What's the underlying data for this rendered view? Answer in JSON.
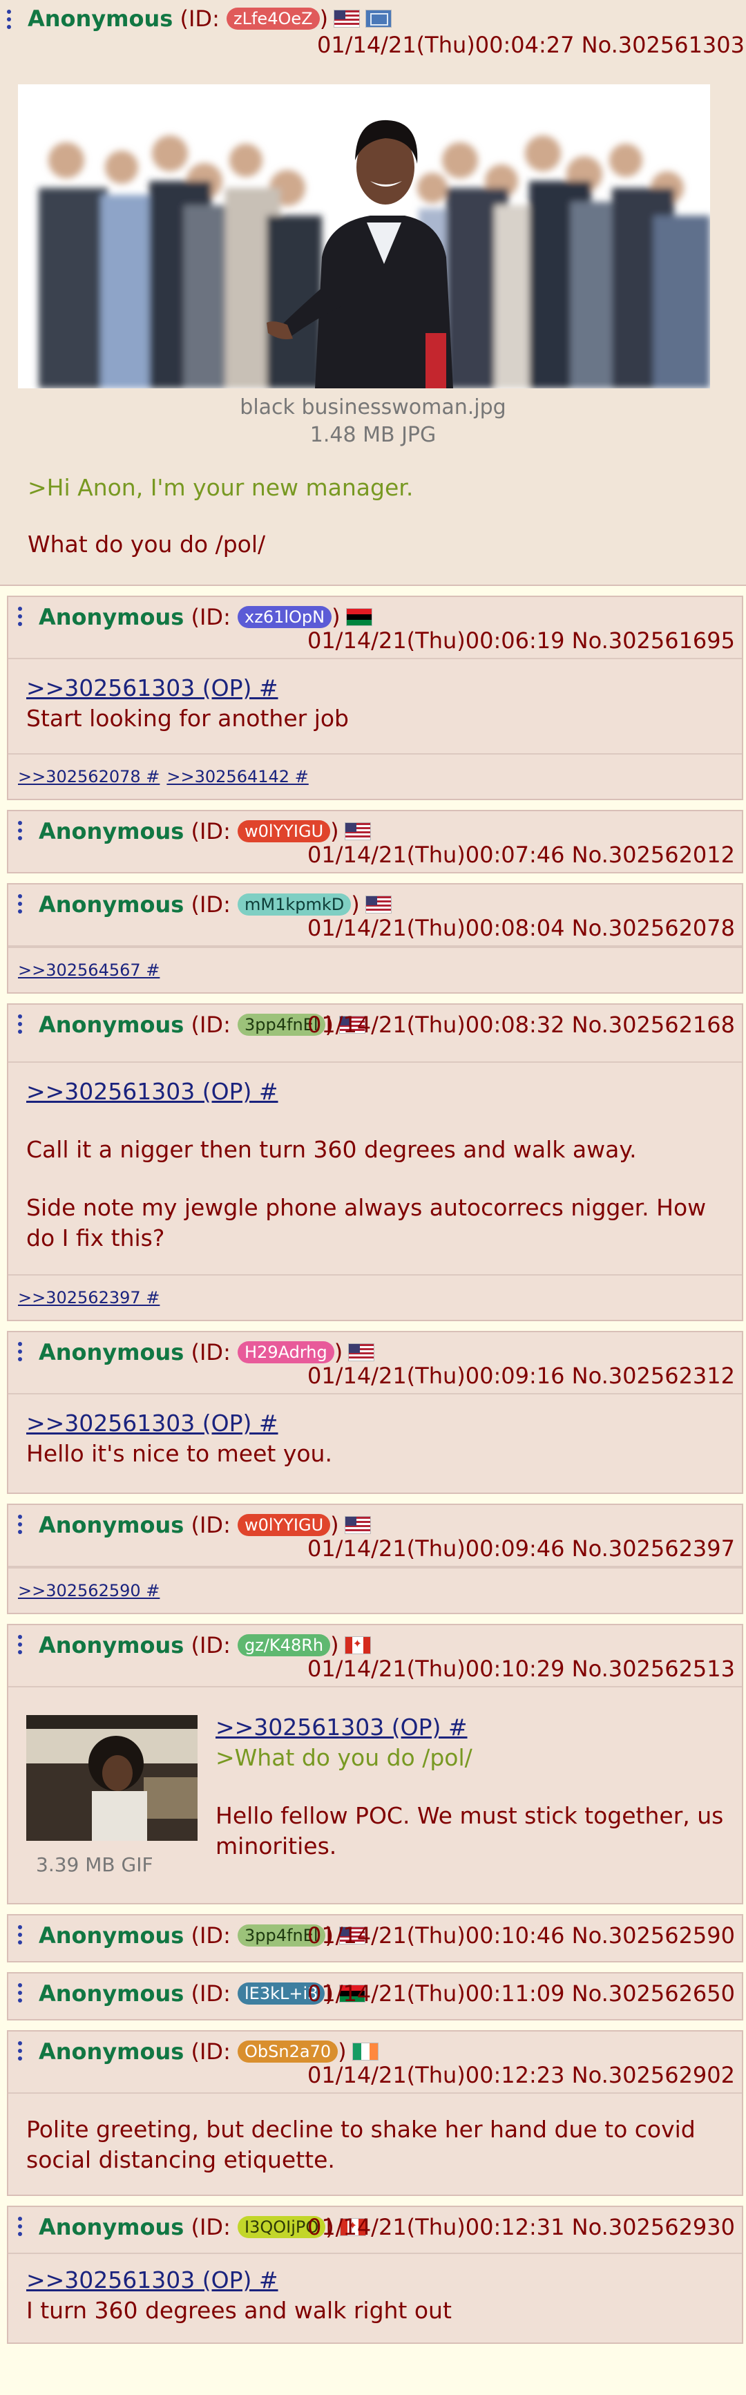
{
  "op": {
    "name": "Anonymous",
    "id_open": " (ID: ",
    "id": "zLfe4OeZ",
    "id_color": "#e05a5a",
    "id_close": ")",
    "flags": [
      "us-flag-icon",
      "state-flag-icon"
    ],
    "date": "01/14/21(Thu)00:04:27",
    "number": "No.302561303",
    "file_name": "black businesswoman.jpg",
    "file_info": "1.48 MB JPG",
    "greentext": ">Hi Anon, I'm your new manager.",
    "text": "What do you do /pol/"
  },
  "posts": [
    {
      "name": "Anonymous",
      "id_open": " (ID: ",
      "id": "xz61lOpN",
      "id_color": "#5b5bd6",
      "id_close": ")",
      "flag": "pan-african-flag-icon",
      "date": "01/14/21(Thu)00:06:19 No.302561695",
      "quote": ">>302561303 (OP) #",
      "text": "Start looking for another job",
      "replies": [
        ">>302562078 #",
        ">>302564142 #"
      ]
    },
    {
      "name": "Anonymous",
      "id_open": " (ID: ",
      "id": "w0lYYIGU",
      "id_color": "#e0442c",
      "id_close": ")",
      "flag": "us-flag-icon",
      "date": "01/14/21(Thu)00:07:46 No.302562012"
    },
    {
      "name": "Anonymous",
      "id_open": " (ID: ",
      "id": "mM1kpmkD",
      "id_color": "#7fcfc3",
      "id_close": ")",
      "flag": "us-flag-icon",
      "date": "01/14/21(Thu)00:08:04 No.302562078",
      "replies": [
        ">>302564567 #"
      ]
    },
    {
      "name": "Anonymous",
      "id_open": " (ID: ",
      "id": "3pp4fnEl",
      "id_color": "#9cc27a",
      "id_close": ")",
      "flag": "us-flag-icon",
      "date": "01/14/21(Thu)00:08:32 No.302562168",
      "quote": ">>302561303 (OP) #",
      "text": "Call it a nigger then turn 360 degrees and walk away.",
      "text2": "Side note my jewgle phone always autocorrecs nigger. How do I fix this?",
      "replies": [
        ">>302562397 #"
      ]
    },
    {
      "name": "Anonymous",
      "id_open": " (ID: ",
      "id": "H29Adrhg",
      "id_color": "#e85a9a",
      "id_close": ")",
      "flag": "us-flag-icon",
      "date": "01/14/21(Thu)00:09:16 No.302562312",
      "quote": ">>302561303 (OP) #",
      "text": "Hello it's nice to meet you."
    },
    {
      "name": "Anonymous",
      "id_open": " (ID: ",
      "id": "w0lYYIGU",
      "id_color": "#e0442c",
      "id_close": ")",
      "flag": "us-flag-icon",
      "date": "01/14/21(Thu)00:09:46 No.302562397",
      "replies": [
        ">>302562590 #"
      ]
    },
    {
      "name": "Anonymous",
      "id_open": " (ID: ",
      "id": "gz/K48Rh",
      "id_color": "#5fb870",
      "id_close": ")",
      "flag": "canada-flag-icon",
      "date": "01/14/21(Thu)00:10:29 No.302562513",
      "quote": ">>302561303 (OP) #",
      "greentext": ">What do you do /pol/",
      "text": "Hello fellow POC. We must stick together, us minorities.",
      "file_info": "3.39 MB GIF"
    },
    {
      "name": "Anonymous",
      "id_open": " (ID: ",
      "id": "3pp4fnEl",
      "id_color": "#9cc27a",
      "id_close": ")",
      "flag": "us-flag-icon",
      "date": "01/14/21(Thu)00:10:46 No.302562590"
    },
    {
      "name": "Anonymous",
      "id_open": " (ID: ",
      "id": "lE3kL+i3",
      "id_color": "#3e7fa0",
      "id_close": ")",
      "flag": "pan-african-flag-icon",
      "date": "01/14/21(Thu)00:11:09 No.302562650"
    },
    {
      "name": "Anonymous",
      "id_open": " (ID: ",
      "id": "ObSn2a70",
      "id_color": "#d98f2e",
      "id_close": ")",
      "flag": "ireland-flag-icon",
      "date": "01/14/21(Thu)00:12:23 No.302562902",
      "text": "Polite greeting, but decline to shake her hand due to covid social distancing etiquette."
    },
    {
      "name": "Anonymous",
      "id_open": " (ID: ",
      "id": "I3QOIjPO",
      "id_color": "#c2d62a",
      "id_close": ")",
      "flag": "canada-flag-icon",
      "date": "01/14/21(Thu)00:12:31 No.302562930",
      "quote": ">>302561303 (OP) #",
      "text": "I turn 360 degrees and walk right out"
    }
  ]
}
